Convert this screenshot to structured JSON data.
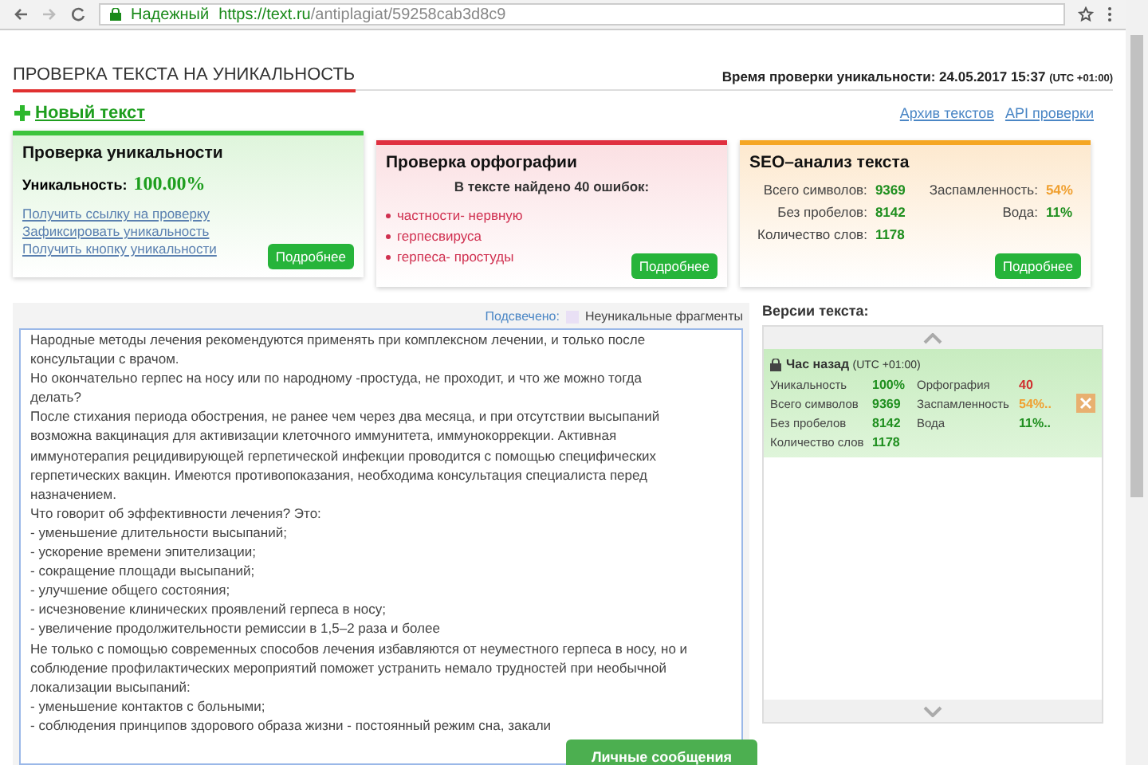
{
  "browser": {
    "secure_label": "Надежный",
    "url_host": "https://text.ru",
    "url_path": "/antiplagiat/59258cab3d8c9"
  },
  "page": {
    "title": "ПРОВЕРКА ТЕКСТА НА УНИКАЛЬНОСТЬ",
    "check_time_label": "Время проверки уникальности: 24.05.2017 15:37",
    "check_time_zone": "(UTC +01:00)",
    "new_text": "Новый текст",
    "links": [
      "Архив текстов",
      "API проверки"
    ]
  },
  "cards": [
    {
      "kind": "uniqueness",
      "title": "Проверка уникальности",
      "label": "Уникальность:",
      "value": "100.00%",
      "links": [
        "Получить ссылку на проверку",
        "Зафиксировать уникальность",
        "Получить кнопку уникальности"
      ],
      "button": "Подробнее"
    },
    {
      "kind": "spelling",
      "title": "Проверка орфографии",
      "summary": "В тексте найдено 40 ошибок:",
      "errors": [
        "частности- нервную",
        "герпесвируса",
        "герпеса- простуды"
      ],
      "button": "Подробнее"
    },
    {
      "kind": "seo",
      "title": "SEO–анализ текста",
      "stats": [
        {
          "label": "Всего символов:",
          "value": "9369",
          "color": "#1f8f1f"
        },
        {
          "label": "Заспамленность:",
          "value": "54%",
          "color": "#f0a030"
        },
        {
          "label": "Без пробелов:",
          "value": "8142",
          "color": "#1f8f1f"
        },
        {
          "label": "Вода:",
          "value": "11%",
          "color": "#1f8f1f"
        },
        {
          "label": "Количество слов:",
          "value": "1178",
          "color": "#1f8f1f"
        }
      ],
      "button": "Подробнее"
    }
  ],
  "text_panel": {
    "highlight_label": "Подсвечено:",
    "legend": "Неуникальные фрагменты",
    "lines": [
      "Народные методы лечения рекомендуются применять при комплексном лечении, и только после",
      "консультации с врачом.",
      "Но окончательно герпес на носу или по народному -простуда, не проходит, и что же можно тогда",
      "делать?",
      "После стихания периода обострения, не ранее чем через два месяца, и при отсутствии высыпаний",
      "возможна вакцинация для активизации клеточного иммунитета, иммунокоррекции. Активная",
      "иммунотерапия рецидивирующей герпетической инфекции проводится с помощью специфических",
      "герпетических вакцин. Имеются противопоказания, необходима консультация специалиста перед",
      "назначением.",
      "Что говорит об эффективности лечения? Это:",
      "- уменьшение длительности высыпаний;",
      "- ускорение времени эпителизации;",
      "- сокращение площади высыпаний;",
      "- улучшение общего состояния;",
      "- исчезновение клинических проявлений герпеса в носу;",
      "- увеличение продолжительности ремиссии в 1,5–2 раза и более",
      "Не только с помощью современных способов лечения избавляются от неуместного герпеса в носу, но и",
      "соблюдение профилактических мероприятий поможет устранить немало трудностей при необычной",
      "локализации высыпаний:",
      "- уменьшение контактов с больными;",
      "- соблюдения принципов здорового образа жизни - постоянный режим сна, закали"
    ]
  },
  "versions": {
    "title": "Версии текста:",
    "items": [
      {
        "time": "Час назад",
        "zone": "(UTC +01:00)",
        "selected": true,
        "stats": [
          {
            "label": "Уникальность",
            "value": "100%",
            "color": "#1f8f1f"
          },
          {
            "label": "Орфография",
            "value": "40",
            "color": "#d03030"
          },
          {
            "label": "Всего символов",
            "value": "9369",
            "color": "#1f8f1f"
          },
          {
            "label": "Заспамленность",
            "value": "54%..",
            "color": "#f0a030"
          },
          {
            "label": "Без пробелов",
            "value": "8142",
            "color": "#1f8f1f"
          },
          {
            "label": "Вода",
            "value": "11%..",
            "color": "#1f8f1f"
          },
          {
            "label": "Количество слов",
            "value": "1178",
            "color": "#1f8f1f"
          }
        ]
      }
    ]
  },
  "messages_button": "Личные сообщения"
}
